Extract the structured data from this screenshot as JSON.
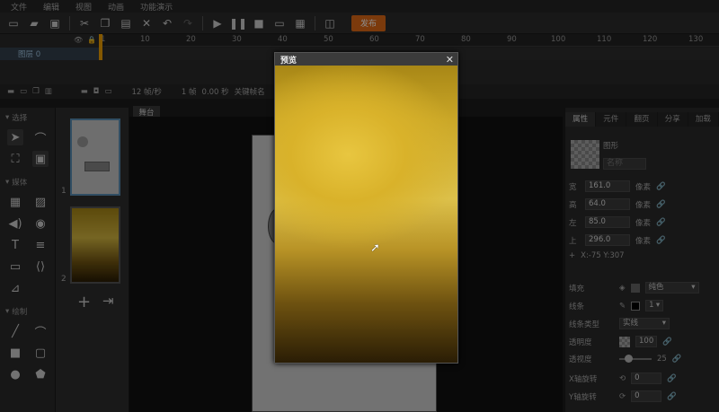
{
  "menu": [
    "文件",
    "编辑",
    "视图",
    "动画",
    "功能演示"
  ],
  "toolbar": {
    "publish_label": "发布"
  },
  "timeline": {
    "ticks": [
      "1",
      "10",
      "20",
      "30",
      "40",
      "50",
      "60",
      "70",
      "80",
      "90",
      "100",
      "110",
      "120",
      "130"
    ],
    "layer_name": "图层 0",
    "fps": "12 帧/秒",
    "frame": "1 帧",
    "time": "0.00 秒",
    "keyframe_name": "关键帧名"
  },
  "tools": {
    "section_select": "选择",
    "section_media": "媒体",
    "section_draw": "绘制"
  },
  "pages": {
    "page1": "1",
    "page2": "2"
  },
  "stage": {
    "tab_label": "舞台"
  },
  "props": {
    "tabs": [
      "属性",
      "元件",
      "翻页",
      "分享",
      "加载"
    ],
    "object_type": "图形",
    "name_placeholder": "名称",
    "width_label": "宽",
    "width_value": "161.0",
    "height_label": "高",
    "height_value": "64.0",
    "left_label": "左",
    "left_value": "85.0",
    "top_label": "上",
    "top_value": "296.0",
    "unit": "像素",
    "coords": "X:-75    Y:307",
    "fill_label": "填充",
    "fill_type": "纯色",
    "stroke_label": "线条",
    "stroke_width": "1",
    "stroke_type_label": "线条类型",
    "stroke_type": "实线",
    "opacity_label": "透明度",
    "opacity_value": "100",
    "perspective_label": "透视度",
    "perspective_value": "25",
    "xrot_label": "X轴旋转",
    "xrot_value": "0",
    "yrot_label": "Y轴旋转",
    "yrot_value": "0"
  },
  "preview": {
    "title": "预览"
  }
}
